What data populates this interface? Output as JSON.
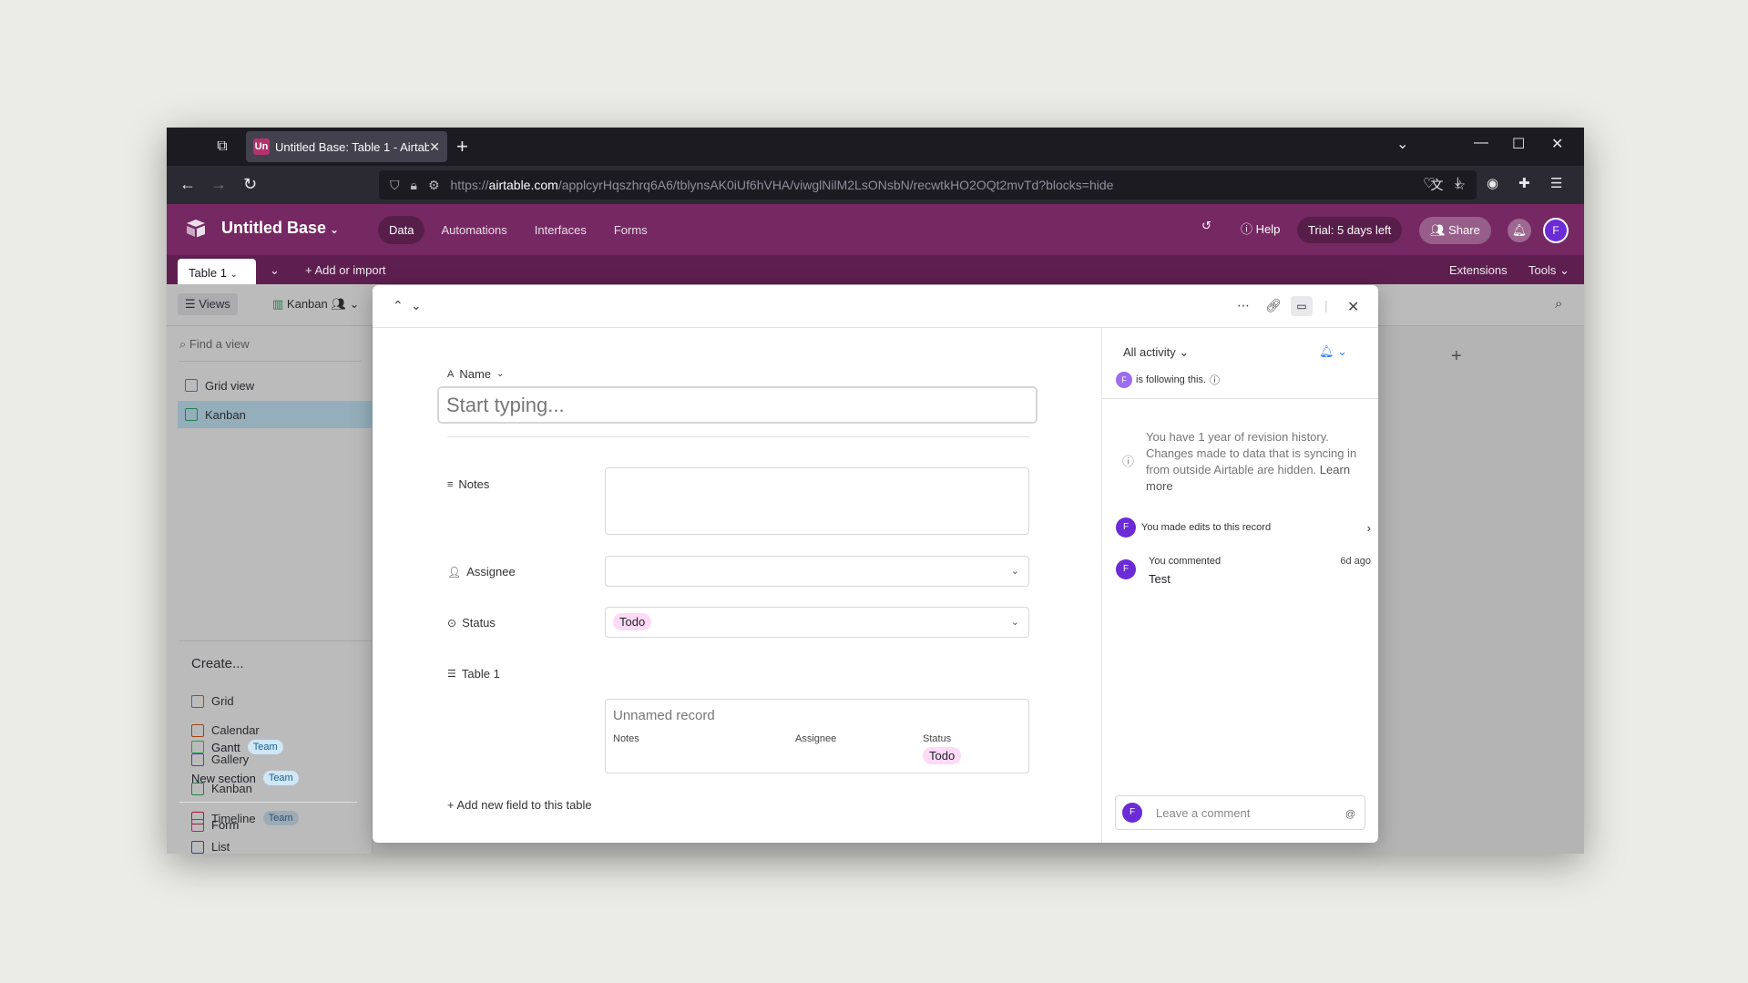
{
  "browser": {
    "tab_favicon": "Un",
    "tab_title": "Untitled Base: Table 1 - Airtable",
    "url_domain": "airtable.com",
    "url_prefix": "https://",
    "url_path": "/applcyrHqszhrq6A6/tblynsAK0iUf6hVHA/viwglNilM2LsONsbN/recwtkHO2OQt2mvTd?blocks=hide"
  },
  "app": {
    "base_name": "Untitled Base",
    "nav": [
      "Data",
      "Automations",
      "Interfaces",
      "Forms"
    ],
    "help": "Help",
    "trial": "Trial: 5 days left",
    "share": "Share",
    "avatar": "F"
  },
  "tablebar": {
    "table_tab": "Table 1",
    "add_import": "Add or import",
    "extensions": "Extensions",
    "tools": "Tools"
  },
  "viewbar": {
    "views": "Views",
    "kanban": "Kanban"
  },
  "sidebar": {
    "find_placeholder": "Find a view",
    "views": [
      "Grid view",
      "Kanban"
    ],
    "create_heading": "Create...",
    "create": [
      {
        "label": "Grid",
        "badge": ""
      },
      {
        "label": "Calendar",
        "badge": ""
      },
      {
        "label": "Gallery",
        "badge": ""
      },
      {
        "label": "Kanban",
        "badge": ""
      },
      {
        "label": "Timeline",
        "badge": "Team"
      },
      {
        "label": "List",
        "badge": ""
      },
      {
        "label": "Gantt",
        "badge": "Team"
      },
      {
        "label": "New section",
        "badge": "Team"
      },
      {
        "label": "Form",
        "badge": ""
      }
    ]
  },
  "record": {
    "name_label": "Name",
    "name_placeholder": "Start typing...",
    "notes_label": "Notes",
    "assignee_label": "Assignee",
    "status_label": "Status",
    "status_value": "Todo",
    "table1_label": "Table 1",
    "linked_record": "Unnamed record",
    "linked_cols": [
      "Notes",
      "Assignee",
      "Status"
    ],
    "linked_status": "Todo",
    "add_field": "Add new field to this table"
  },
  "activity": {
    "filter": "All activity",
    "follow_avatar": "F",
    "following": "is following this.",
    "revision_text": "You have 1 year of revision history. Changes made to data that is syncing in from outside Airtable are hidden.",
    "learn_more": "Learn more",
    "edit_entry": "You made edits to this record",
    "comment_author": "You commented",
    "comment_time": "6d ago",
    "comment_text": "Test",
    "comment_placeholder": "Leave a comment",
    "at_icon": "@"
  },
  "colors": {
    "header": "#762863",
    "tablebar": "#5e1f50",
    "pill": "#ffdaf6",
    "selected_view": "#c4ecff",
    "avatar": "#6b2bd6"
  }
}
